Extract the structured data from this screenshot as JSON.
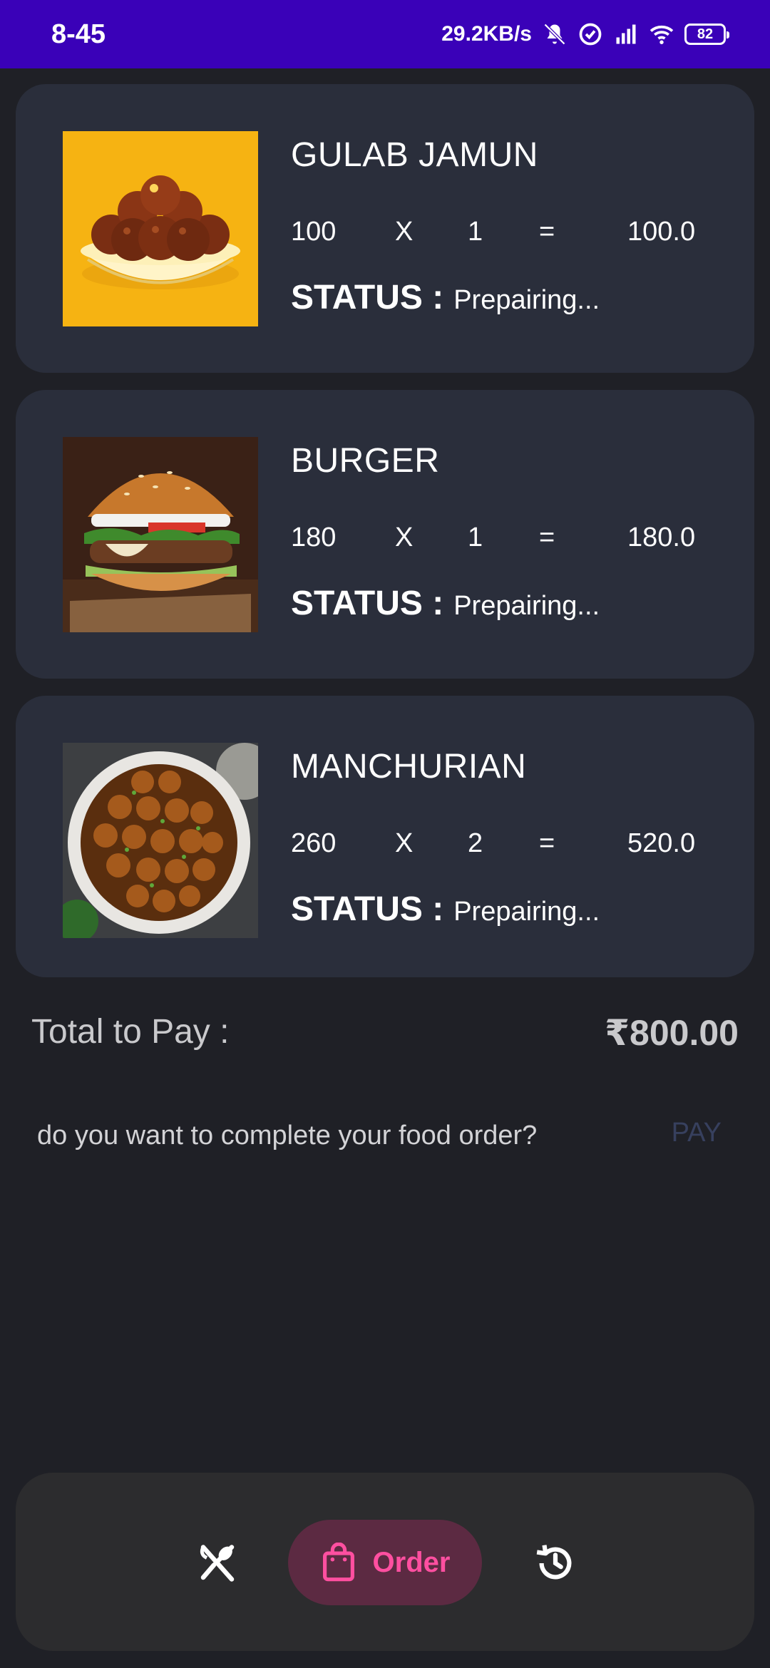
{
  "status_bar": {
    "time": "8-45",
    "speed": "29.2KB/s",
    "battery": "82"
  },
  "orders": [
    {
      "name": "GULAB JAMUN",
      "price": "100",
      "times": "X",
      "qty": "1",
      "equals": "=",
      "total": "100.0",
      "status_label": "STATUS :",
      "status": "Prepairing..."
    },
    {
      "name": "BURGER",
      "price": "180",
      "times": "X",
      "qty": "1",
      "equals": "=",
      "total": "180.0",
      "status_label": "STATUS :",
      "status": "Prepairing..."
    },
    {
      "name": "MANCHURIAN",
      "price": "260",
      "times": "X",
      "qty": "2",
      "equals": "=",
      "total": "520.0",
      "status_label": "STATUS :",
      "status": "Prepairing..."
    }
  ],
  "summary": {
    "total_label": "Total to Pay :",
    "total_amount": "₹800.00",
    "prompt": "do you want to complete your food order?",
    "pay_label": "PAY"
  },
  "nav": {
    "items": [
      {
        "icon": "fork-spoon-icon"
      },
      {
        "icon": "shopping-bag-icon",
        "label": "Order"
      },
      {
        "icon": "history-icon"
      }
    ]
  },
  "colors": {
    "status_bar": "#3a01b8",
    "background": "#1f2026",
    "card": "#2a2e3b",
    "pay": "#37405e",
    "nav_active_bg": "#5c2a42",
    "nav_active_fg": "#ff4fa0"
  }
}
